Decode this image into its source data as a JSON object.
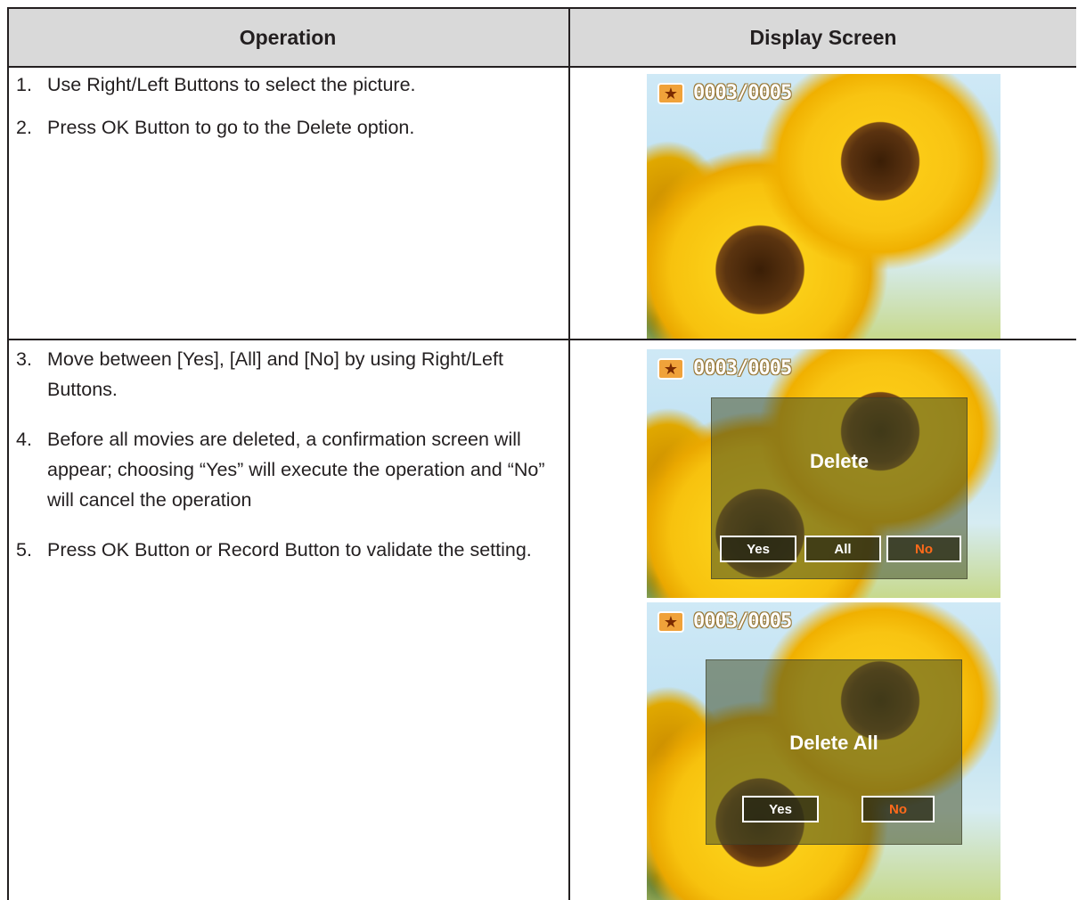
{
  "table": {
    "header_operation": "Operation",
    "header_display": "Display Screen"
  },
  "steps": [
    {
      "num": "1.",
      "text": "Use Right/Left Buttons to select the picture."
    },
    {
      "num": "2.",
      "text": "Press OK Button to go to the Delete option."
    },
    {
      "num": "3.",
      "text": "Move between [Yes], [All] and [No] by using Right/Left Buttons."
    },
    {
      "num": "4.",
      "text": "Before all movies are deleted, a confirmation screen will appear; choosing “Yes” will execute the operation and “No” will cancel the operation"
    },
    {
      "num": "5.",
      "text": "Press OK Button or Record Button to validate the setting."
    }
  ],
  "screens": {
    "counter": "0003/0005",
    "star_icon": "star-icon",
    "delete_dialog": {
      "title": "Delete",
      "yes": "Yes",
      "all": "All",
      "no": "No",
      "selected": "No"
    },
    "delete_all_dialog": {
      "title": "Delete All",
      "yes": "Yes",
      "no": "No",
      "selected": "No"
    }
  },
  "colors": {
    "header_bg": "#d9d9d9",
    "selected_button_text": "#ff6a1a",
    "badge": "#f0a23a"
  }
}
